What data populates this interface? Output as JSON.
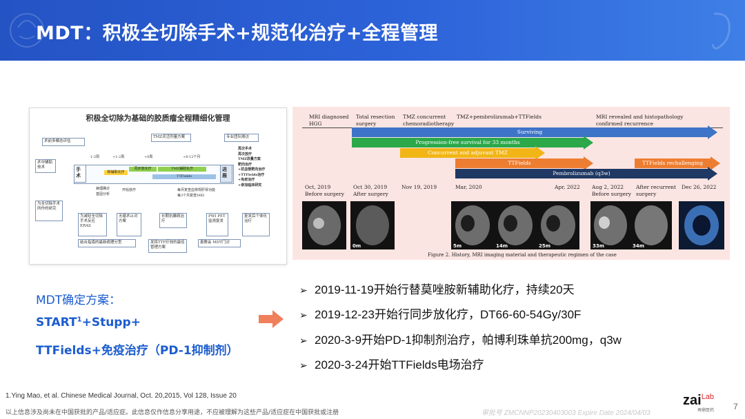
{
  "header": {
    "title": "MDT：积极全切除手术+规范化治疗+全程管理"
  },
  "left_figure": {
    "title": "积极全切除为基础的胶质瘤全程精细化管理",
    "boxes": {
      "pre_op": "术前多模态评估",
      "intra_op": "术中辅助技术",
      "purpose": "为全切除手术所作的研究",
      "tmz": "TMZ灵活剂量方案",
      "team": "专业团队随访",
      "surgery": "手术",
      "eras": "为减轻全切除手术反应ERAS",
      "no_tumor": "无瘤术止对方案",
      "anti_epilepsy": "长期抗癫痫治疗",
      "pwi": "PWI PET监测复发",
      "recur": "复发后个体化治疗",
      "pathology": "结合指南的最新病理分型",
      "ttf_best": "发挥TTF疗效的最佳管理方案",
      "mdt_clinic": "患教会 MDT门诊",
      "progress": "进展"
    },
    "bars": {
      "neoadj": "新辅助化疗",
      "concurrent": "同步放化疗",
      "tmz_adj": "TMZ辅助化疗",
      "ttfields": "TTFields"
    },
    "timeline": [
      "1-2周",
      "+1-2周",
      "+6周",
      "+6-12个月"
    ],
    "notes": {
      "path": "病理确诊\n基因分析",
      "start": "开始放疗",
      "followup": "每月复查血常规肝肾功能\n每3个月复查MRI"
    },
    "right_list": [
      "再次手术",
      "再次放疗",
      "TMZ改量方案",
      "靶向治疗",
      "+抗血管靶向治疗",
      "+TTFields治疗",
      "+免疫治疗",
      "+参加临床研究"
    ]
  },
  "right_figure": {
    "top_labels": [
      "MRI diagnosed\nHGG",
      "Total resection\nsurgery",
      "TMZ concurrent\nchemoradiotherapy",
      "TMZ+pembrolizumab+TTFields",
      "MRI revealed and histopathology\nconfirmed recurrence"
    ],
    "bars": [
      {
        "label": "Surviving",
        "color": "#3e74c7"
      },
      {
        "label": "Progression-free survival for 33 months",
        "color": "#2aa84a"
      },
      {
        "label": "Concurrent and adjuvant TMZ",
        "color": "#f1b516"
      },
      {
        "label": "TTFields",
        "color": "#ed7d31"
      },
      {
        "label": "TTFields rechallenging",
        "color": "#ed7d31"
      },
      {
        "label": "Pembrolizumab (q3w)",
        "color": "#1f3864"
      }
    ],
    "dates": [
      "Oct, 2019\nBefore surgery",
      "Oct 30, 2019\nAfter surgery",
      "Nov 19, 2019",
      "Mar, 2020",
      "Apr, 2022",
      "Aug 2, 2022\nBefore surgery",
      "After recurrent\nsurgery",
      "Dec 26, 2022"
    ],
    "scan_labels": [
      "0m",
      "5m",
      "14m",
      "25m",
      "33m",
      "34m"
    ],
    "caption": "Figure 2. History, MRI imaging material and therapeutic regimen of the case"
  },
  "mdt": {
    "title": "MDT确定方案：",
    "line1_a": "START",
    "line1_sup": "1",
    "line1_b": "+Stupp+",
    "line2": "TTFields+免疫治疗（PD-1抑制剂）"
  },
  "bullets": [
    "2019-11-19开始行替莫唑胺新辅助化疗，持续20天",
    "2019-12-23开始行同步放化疗，DT66-60-54Gy/30F",
    "2020-3-9开始PD-1抑制剂治疗，帕博利珠单抗200mg，q3w",
    "2020-3-24开始TTFields电场治疗"
  ],
  "bullet_marker": "➢",
  "footer": {
    "reference": "1.Ying Mao, et al. Chinese Medical Journal, Oct. 20,2015, Vol 128, Issue 20",
    "disclaimer": "以上信息涉及尚未在中国获批的产品/适应症。此信息仅作信息分享用途，不应被理解为这些产品/适应症在中国获批或注册",
    "approval": "审批号 ZMCNNP20230403003 Expire Date 2024/04/03",
    "logo_main": "zai",
    "logo_sub": "Lab",
    "logo_cn": "再鼎医药",
    "page_number": "7"
  },
  "colors": {
    "header": "#2453c4",
    "accent": "#1b5ccf",
    "arrow": "#f07f5c"
  }
}
